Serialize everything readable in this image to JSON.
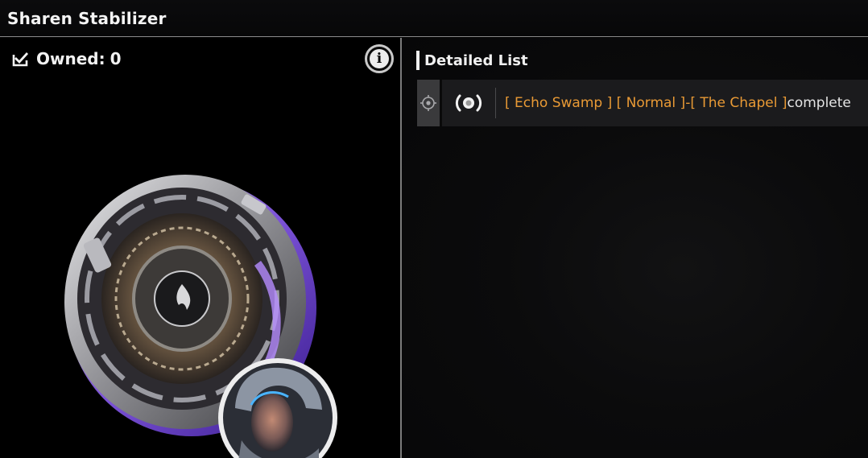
{
  "window": {
    "title": "Sharen Stabilizer"
  },
  "owned": {
    "label": "Owned:",
    "count": "0",
    "icon": "check-box-icon"
  },
  "info": {
    "icon": "info-icon",
    "glyph": "i"
  },
  "detail": {
    "header": "Detailed List",
    "rows": [
      {
        "locate_icon": "locate-target-icon",
        "signal_icon": "broadcast-signal-icon",
        "parts": {
          "region": "[ Echo Swamp ]",
          "difficulty": "[ Normal ]",
          "dash": " - ",
          "stage": "[ The Chapel ]",
          "status": " complete"
        }
      }
    ]
  },
  "colors": {
    "accent_orange": "#e99a35",
    "panel_bg": "#000000",
    "row_bg": "#1b1b1d",
    "divider": "#7b7b7b"
  }
}
